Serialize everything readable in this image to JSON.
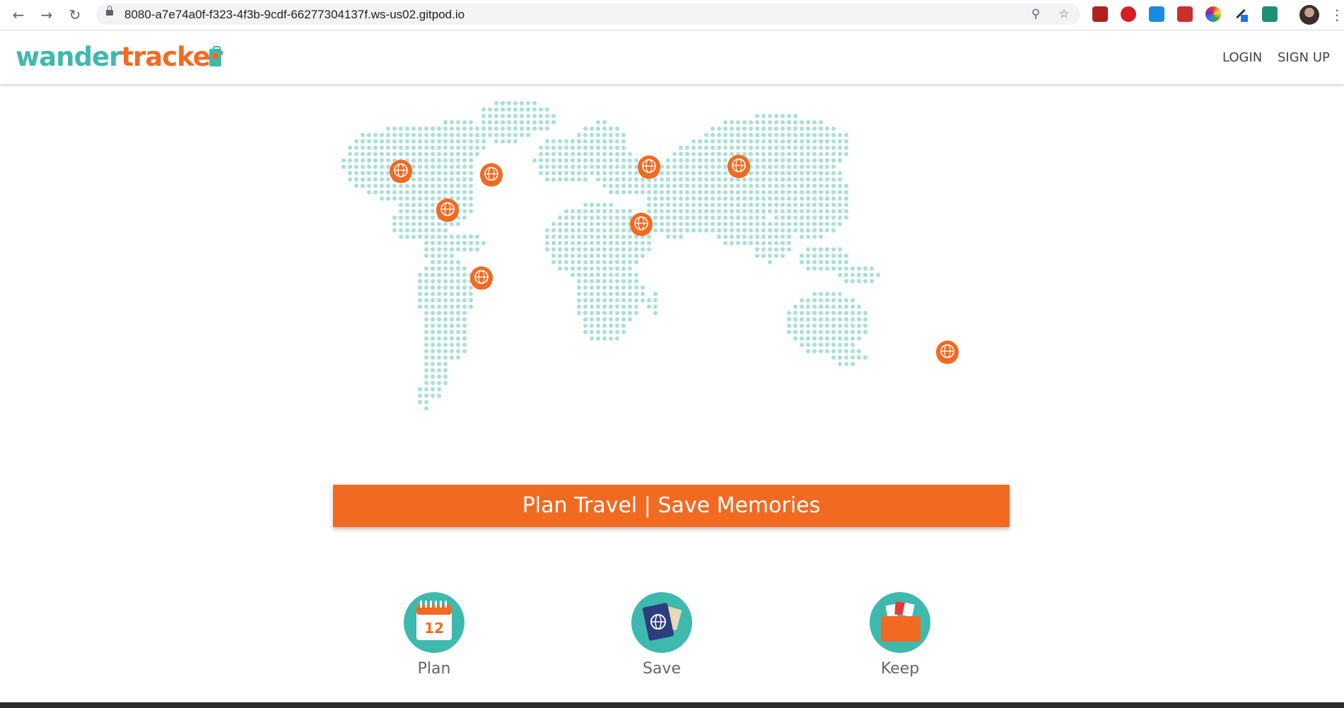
{
  "browser": {
    "url": "8080-a7e74a0f-f323-4f3b-9cdf-66277304137f.ws-us02.gitpod.io",
    "nav": {
      "back_icon": "←",
      "forward_icon": "→",
      "reload_icon": "↻"
    },
    "omnibox_icons": {
      "zoom_icon": "⚲",
      "star_icon": "☆"
    },
    "menu_icon": "⋮"
  },
  "header": {
    "logo_part1": "wander",
    "logo_part2": "tracker",
    "nav": [
      {
        "label": "LOGIN"
      },
      {
        "label": "SIGN UP"
      }
    ]
  },
  "hero": {
    "tagline": "Plan Travel | Save Memories"
  },
  "features": [
    {
      "label": "Plan",
      "icon": "calendar-icon",
      "calendar_number": "12"
    },
    {
      "label": "Save",
      "icon": "passport-icon"
    },
    {
      "label": "Keep",
      "icon": "folder-icon"
    }
  ],
  "colors": {
    "brand_teal": "#3eb9ad",
    "brand_orange": "#f26a22",
    "map_dot": "#a8e0d6"
  }
}
